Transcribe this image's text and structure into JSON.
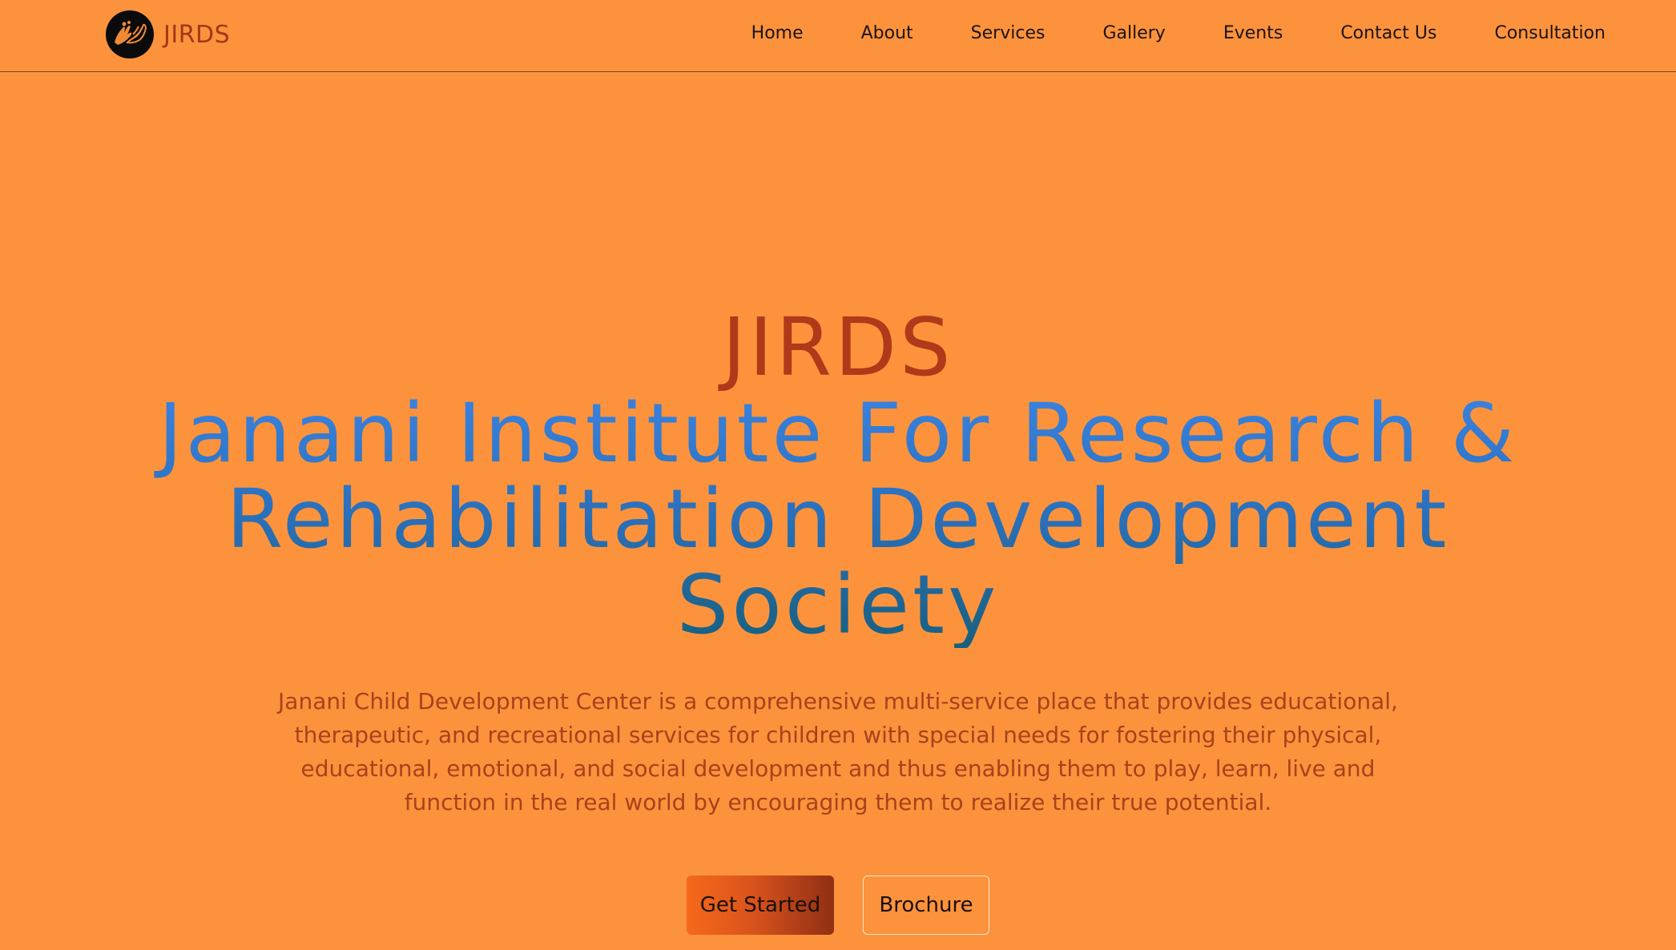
{
  "colors": {
    "background": "#fc933c",
    "brand": "#b0391a",
    "title_gradient_start": "#3a82df",
    "title_gradient_end": "#17607f",
    "description": "#a8421c",
    "button_gradient_start": "#f6691a",
    "button_gradient_end": "#8f2f14"
  },
  "header": {
    "logo_icon": "helping-hands-icon",
    "logo_text": "JIRDS",
    "nav": [
      {
        "label": "Home"
      },
      {
        "label": "About"
      },
      {
        "label": "Services"
      },
      {
        "label": "Gallery"
      },
      {
        "label": "Events"
      },
      {
        "label": "Contact Us"
      },
      {
        "label": "Consultation"
      }
    ]
  },
  "hero": {
    "brand": "JIRDS",
    "title": "Janani Institute For Research & Rehabilitation Development Society",
    "description": "Janani Child Development Center is a comprehensive multi-service place that provides educational, therapeutic, and recreational services for children with special needs for fostering their physical, educational, emotional, and social development and thus enabling them to play, learn, live and function in the real world by encouraging them to realize their true potential.",
    "primary_button": "Get Started",
    "secondary_button": "Brochure"
  }
}
